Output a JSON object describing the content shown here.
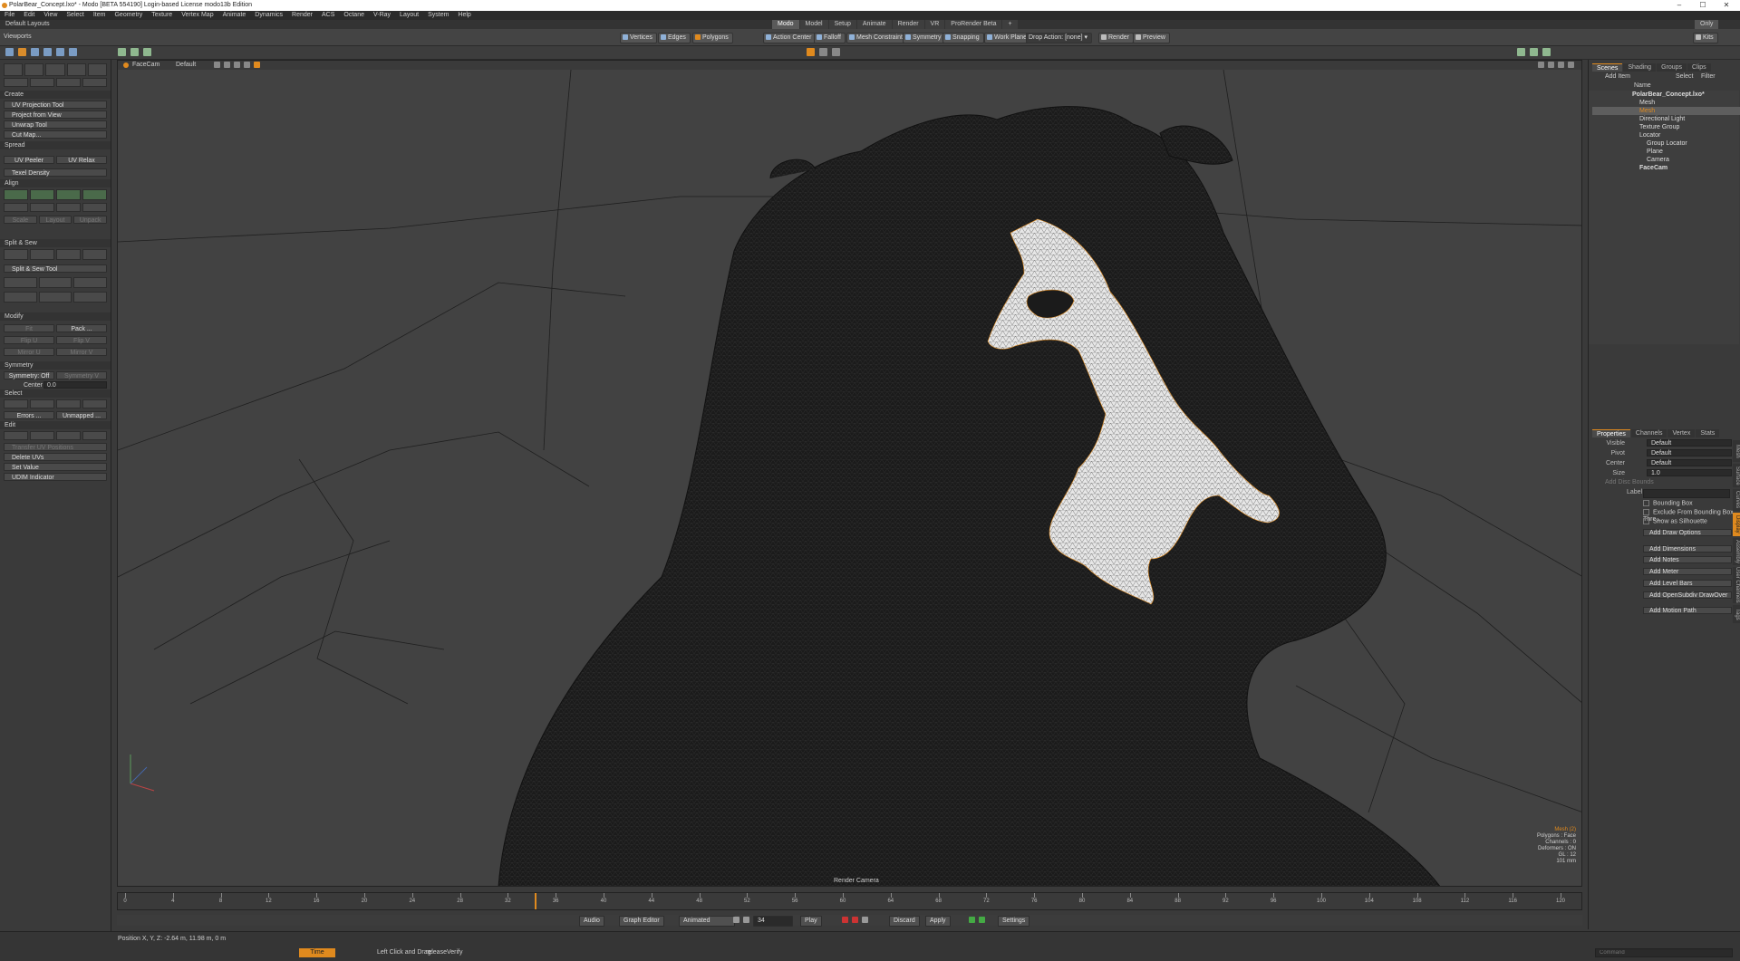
{
  "window": {
    "title": "PolarBear_Concept.lxo* - Modo [BETA 554190] Login-based License modo13b Edition",
    "controls": [
      "–",
      "☐",
      "✕"
    ]
  },
  "menu": [
    "File",
    "Edit",
    "View",
    "Select",
    "Item",
    "Geometry",
    "Texture",
    "Vertex Map",
    "Animate",
    "Dynamics",
    "Render",
    "ACS",
    "Octane",
    "V-Ray",
    "Layout",
    "System",
    "Help"
  ],
  "layout": {
    "name": "Default Layouts",
    "tabs": [
      "Modo",
      "Model",
      "Setup",
      "Animate",
      "Render",
      "VR",
      "ProRender Beta"
    ],
    "active_tab": "Modo",
    "add_tab": "+",
    "only_label": "Only"
  },
  "toolbar": {
    "left_label": "Viewports",
    "modes": [
      "Vertices",
      "Edges",
      "Polygons"
    ],
    "action_center": "Action Center",
    "falloff": "Falloff",
    "mesh_constraint": "Mesh Constraint",
    "symmetry": "Symmetry",
    "snapping": "Snapping",
    "work_plane": "Work Plane",
    "drop_action": "Drop Action: [none]",
    "render": "Render",
    "preview": "Preview",
    "kits": "Kits"
  },
  "left_panel": {
    "create_header": "Create",
    "create_items": [
      "UV Projection Tool",
      "Project from View",
      "Unwrap Tool",
      "Cut Map..."
    ],
    "spread_header": "Spread",
    "uv_peeler": "UV Peeler",
    "uv_relax": "UV Relax",
    "texel_density": "Texel Density",
    "align_header": "Align",
    "scale_labels": [
      "Scale",
      "Layout",
      "Unpack"
    ],
    "split_header": "Split & Sew",
    "split_tool": "Split & Sew Tool",
    "modify_header": "Modify",
    "fit": "Fit",
    "pack": "Pack ...",
    "flip_u": "Flip U",
    "flip_v": "Flip V",
    "mirror_u": "Mirror U",
    "mirror_v": "Mirror V",
    "symmetry_header": "Symmetry",
    "symmetry_off": "Symmetry: Off",
    "symmetry_right": "Symmetry V",
    "center_label": "Center",
    "center_value": "0.0",
    "select_header": "Select",
    "errors": "Errors ...",
    "unmapped": "Unmapped ...",
    "edit_header": "Edit",
    "transfer": "Transfer UV Positions",
    "delete_uvs": "Delete UVs",
    "set_value": "Set Value",
    "udim": "UDIM Indicator"
  },
  "viewport": {
    "camera_name": "FaceCam",
    "shading": "Default",
    "bottom_label": "Render Camera",
    "info_title": "Mesh (2)",
    "info_lines": [
      "Polygons : Face",
      "Channels : 0",
      "Deformers : ON",
      "GL : 12",
      "101 mm"
    ]
  },
  "timeline": {
    "ticks": [
      "0",
      "4",
      "8",
      "12",
      "16",
      "20",
      "24",
      "28",
      "32",
      "36",
      "40",
      "44",
      "48",
      "52",
      "56",
      "60",
      "64",
      "68",
      "72",
      "76",
      "80",
      "84",
      "88",
      "92",
      "96",
      "100",
      "104",
      "108",
      "112",
      "116",
      "120"
    ],
    "range_end": "120"
  },
  "playbar": {
    "audio": "Audio",
    "graph_editor": "Graph Editor",
    "animated": "Animated",
    "frame": "34",
    "play": "Play",
    "discard": "Discard",
    "apply": "Apply",
    "settings": "Settings"
  },
  "status": {
    "position": "Position X, Y, Z: -2.64 m, 11.98 m, 0 m",
    "time": "Time",
    "hint_label": "Left Click and Drag:",
    "hint_value": "releaseVerify",
    "command_placeholder": "Command"
  },
  "right_panel": {
    "scene_tabs": [
      "Scenes",
      "Shading",
      "Groups",
      "Clips"
    ],
    "add_item": "Add Item",
    "select": "Select",
    "filter": "Filter",
    "name_header": "Name",
    "tree": [
      {
        "label": "PolarBear_Concept.lxo*",
        "indent": 0
      },
      {
        "label": "Mesh",
        "indent": 1
      },
      {
        "label": "Mesh",
        "indent": 1
      },
      {
        "label": "Directional Light",
        "indent": 1
      },
      {
        "label": "Texture Group",
        "indent": 1
      },
      {
        "label": "Locator",
        "indent": 1
      },
      {
        "label": "Group Locator",
        "indent": 2
      },
      {
        "label": "Plane",
        "indent": 2
      },
      {
        "label": "Camera",
        "indent": 2
      },
      {
        "label": "FaceCam",
        "indent": 1
      }
    ],
    "selected_index": 2,
    "prop_tabs": [
      "Properties",
      "Channels",
      "Vertex",
      "Stats"
    ],
    "props": [
      {
        "label": "Visible",
        "value": "Default"
      },
      {
        "label": "Pivot",
        "value": "Default"
      },
      {
        "label": "Center",
        "value": "Default"
      },
      {
        "label": "Size",
        "value": "1.0"
      }
    ],
    "disc_bounds": "Add Disc Bounds",
    "label_field": "Label",
    "checkboxes": [
      "Bounding Box",
      "Exclude From Bounding Box Thre...",
      "Show as Silhouette"
    ],
    "buttons": [
      "Add Draw Options",
      "Add Dimensions",
      "Add Notes",
      "Add Meter",
      "Add Level Bars",
      "Add OpenSubdiv DrawOver",
      "Add Motion Path"
    ],
    "side_tabs": [
      "Mesh",
      "Surface",
      "Curves",
      "Display",
      "Assembly",
      "User Channels",
      "Tags"
    ]
  },
  "colors": {
    "accent": "#e08a1e",
    "panel": "#3a3a3a",
    "viewport": "#424242",
    "mesh": "#1c1c1c",
    "uv_island": "#e8e8e8"
  }
}
